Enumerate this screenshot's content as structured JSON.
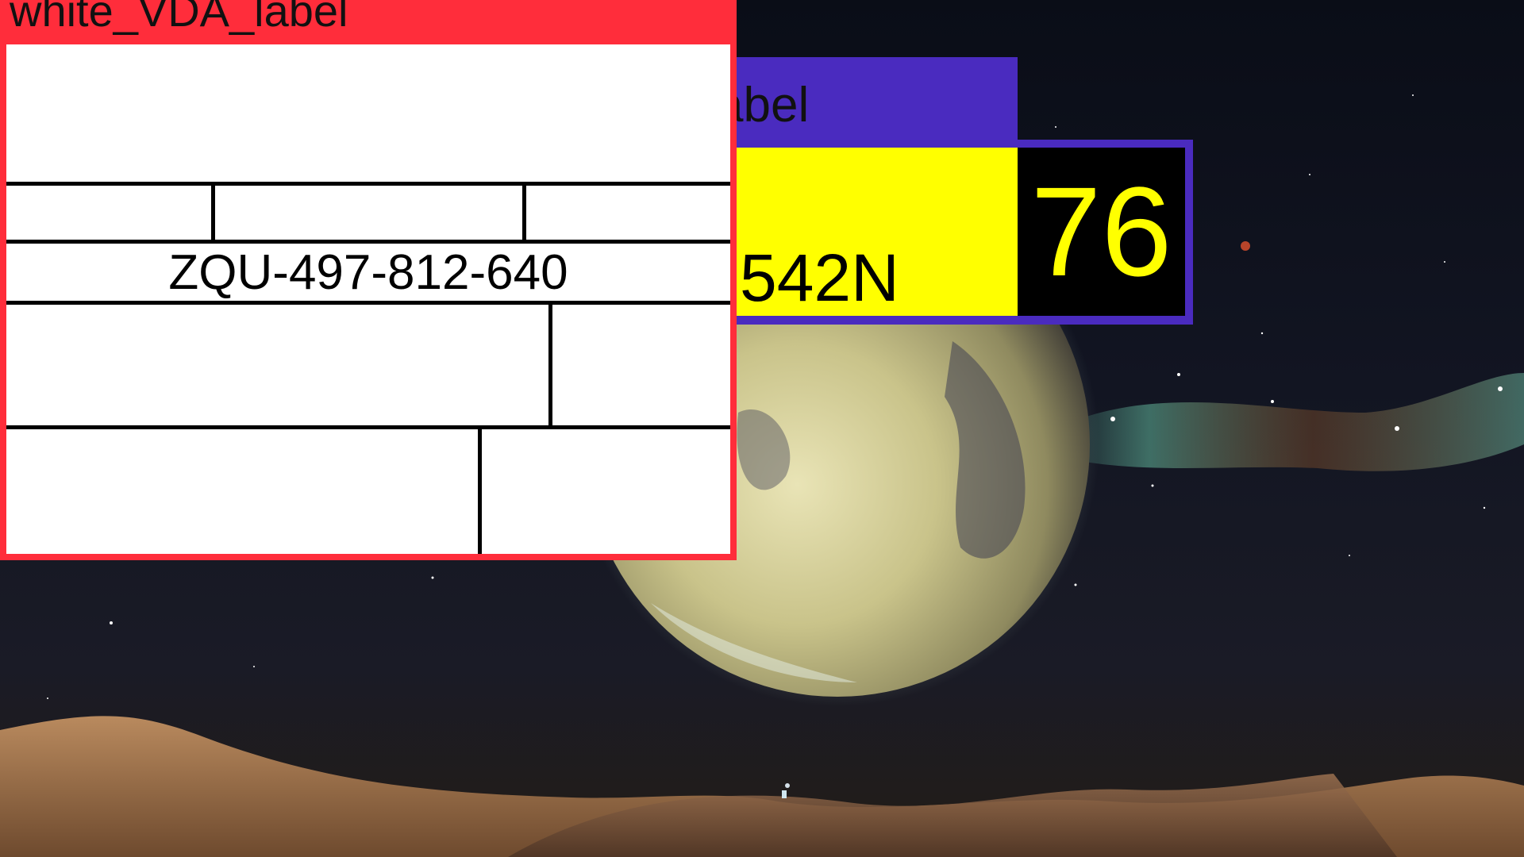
{
  "background": {
    "name": "desert-planet-wallpaper",
    "colors": {
      "sky": "#0a0d17",
      "planet": "#c9c38a",
      "dunes": "#a9805a",
      "nebula": "#7fd9b8"
    }
  },
  "back_label": {
    "header_text": "abel",
    "code_text": "542N",
    "number_text": "76",
    "colors": {
      "frame": "#4a2bbf",
      "panel": "#ffff00",
      "number_box": "#000000",
      "number_text": "#ffff00"
    }
  },
  "front_label": {
    "title": "white_VDA_label",
    "code_text": "ZQU-497-812-640",
    "colors": {
      "frame": "#ff2d3b",
      "panel": "#ffffff",
      "grid_lines": "#000000"
    }
  }
}
